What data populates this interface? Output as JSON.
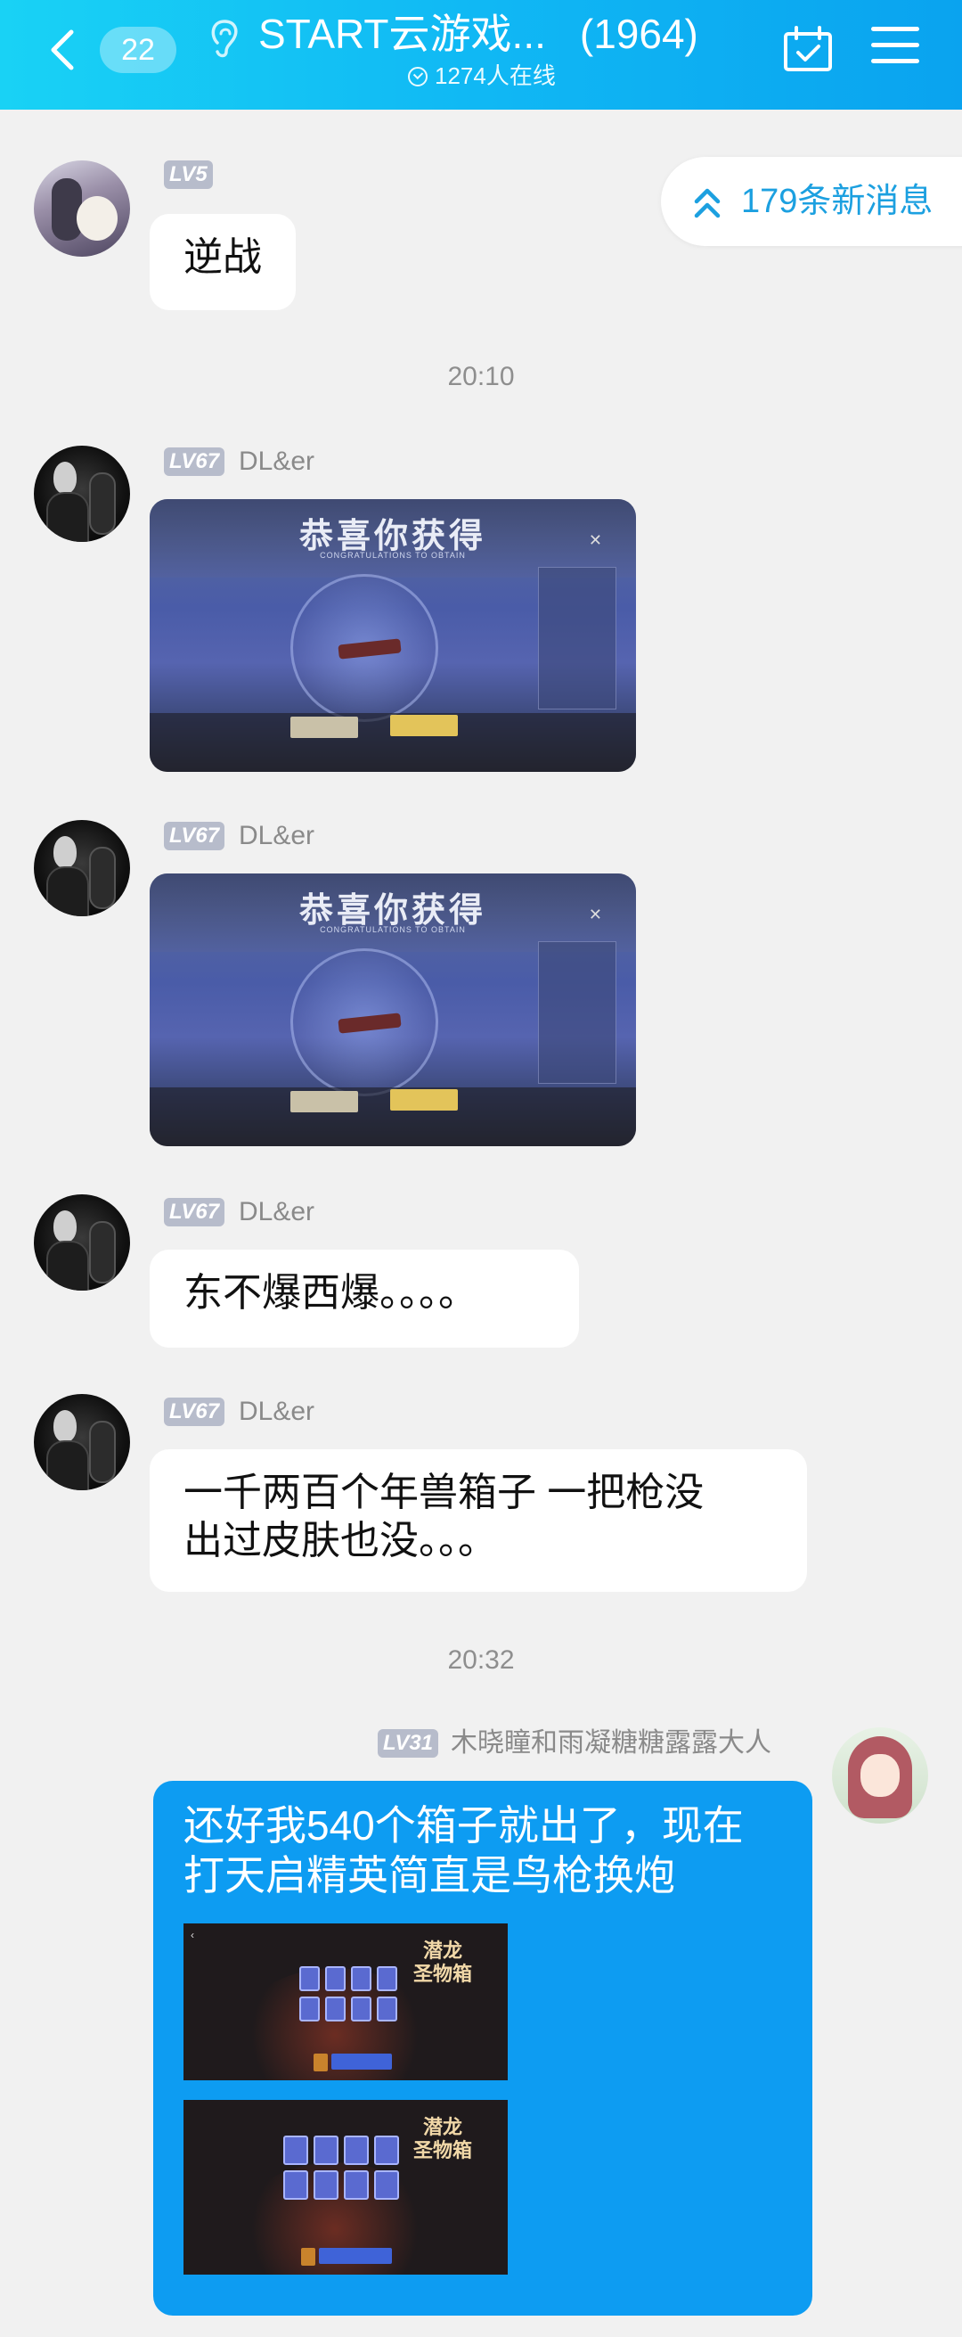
{
  "header": {
    "unread_count": "22",
    "title": "START云游戏...",
    "member_count": "(1964)",
    "online": "1274人在线"
  },
  "new_messages": "179条新消息",
  "messages": [
    {
      "level": "LV5",
      "name": "",
      "text": "逆战"
    },
    {
      "time": "20:10"
    },
    {
      "level": "LV67",
      "name": "DL&er",
      "image_title": "恭喜你获得",
      "image_sub": "CONGRATULATIONS TO OBTAIN"
    },
    {
      "level": "LV67",
      "name": "DL&er",
      "image_title": "恭喜你获得",
      "image_sub": "CONGRATULATIONS TO OBTAIN"
    },
    {
      "level": "LV67",
      "name": "DL&er",
      "text": "东不爆西爆。。。。"
    },
    {
      "level": "LV67",
      "name": "DL&er",
      "text_line1": "一千两百个年兽箱子  一把枪没",
      "text_line2": "出过皮肤也没。。。"
    },
    {
      "time": "20:32"
    },
    {
      "level": "LV31",
      "name": "木晓瞳和雨凝糖糖露露大人",
      "text_line1": "还好我540个箱子就出了，现在",
      "text_line2": "打天启精英简直是鸟枪换炮",
      "image_logo": "潜龙\n圣物箱"
    }
  ],
  "colors": {
    "header_start": "#19d2f5",
    "header_end": "#0aa3ef",
    "sent_bubble": "#0d9cf2",
    "new_msg_text": "#1ca0e0",
    "level_badge": "#b7bccb"
  },
  "icons": [
    "back-chevron-icon",
    "ear-icon",
    "calendar-check-icon",
    "menu-icon",
    "double-chevron-up-icon"
  ]
}
